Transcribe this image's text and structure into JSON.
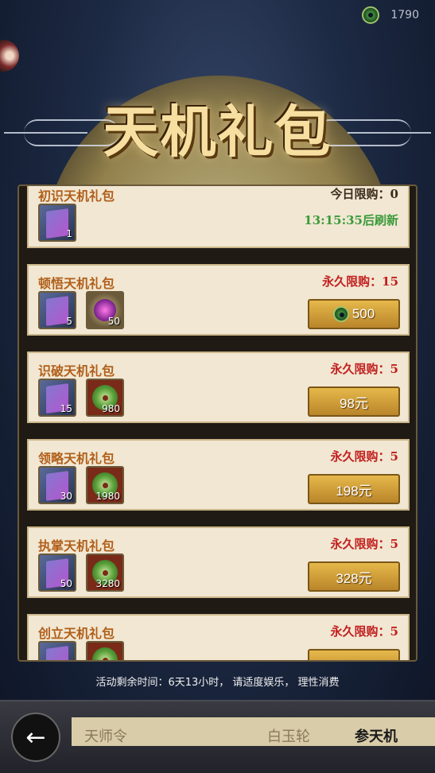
{
  "currency": {
    "icon": "jade-coin-icon",
    "amount": "1790"
  },
  "title": "天机礼包",
  "packs": [
    {
      "name": "初识天机礼包",
      "limit": "今日限购：0",
      "items": [
        {
          "type": "book",
          "qty": "1"
        }
      ],
      "refresh": "13:15:35后刷新"
    },
    {
      "name": "顿悟天机礼包",
      "limit": "永久限购：15",
      "items": [
        {
          "type": "book",
          "qty": "5"
        },
        {
          "type": "orb",
          "qty": "50"
        }
      ],
      "price": "500",
      "price_icon": "jade-coin-icon"
    },
    {
      "name": "识破天机礼包",
      "limit": "永久限购：5",
      "items": [
        {
          "type": "book",
          "qty": "15"
        },
        {
          "type": "jade",
          "qty": "980"
        }
      ],
      "price": "98元"
    },
    {
      "name": "领略天机礼包",
      "limit": "永久限购：5",
      "items": [
        {
          "type": "book",
          "qty": "30"
        },
        {
          "type": "jade",
          "qty": "1980"
        }
      ],
      "price": "198元"
    },
    {
      "name": "执掌天机礼包",
      "limit": "永久限购：5",
      "items": [
        {
          "type": "book",
          "qty": "50"
        },
        {
          "type": "jade",
          "qty": "3280"
        }
      ],
      "price": "328元"
    },
    {
      "name": "创立天机礼包",
      "limit": "永久限购：5",
      "items": [
        {
          "type": "book",
          "qty": ""
        },
        {
          "type": "jade",
          "qty": ""
        }
      ],
      "price": ""
    }
  ],
  "notice": "活动剩余时间：6天13小时， 请适度娱乐， 理性消费",
  "tabs": [
    "天师令",
    "",
    "白玉轮",
    "参天机"
  ],
  "active_tab": 3
}
